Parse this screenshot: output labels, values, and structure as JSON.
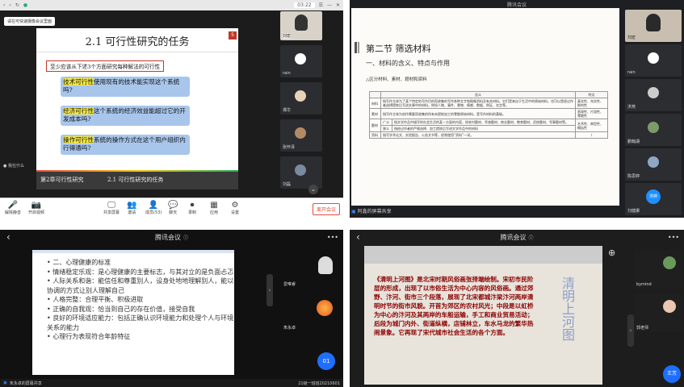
{
  "q1": {
    "browser_time": "03:22",
    "tooltip": "请在可快速摄像会议里面",
    "slide_badge": "5",
    "slide_title": "2.1 可行性研究的任务",
    "slide_intro": "至少应该从下述3个方面研究每种解法的可行性",
    "slide_items": [
      {
        "hl": "技术可行性",
        "rest": "使用现有的技术能实现这个系统吗?"
      },
      {
        "hl": "经济可行性",
        "rest": "这个系统的经济效益能超过它的开发成本吗?"
      },
      {
        "hl": "操作可行性",
        "rest": "系统的操作方式在这个用户组织内行得通吗?"
      }
    ],
    "footer_left": "第2章可行性研究",
    "footer_right": "2.1 可行性研究的任务",
    "presenter_label": "我在什么",
    "participants": [
      "刘宏",
      "rain",
      "谭华",
      "张怀泽",
      "刘磊"
    ],
    "toolbar": [
      {
        "icon": "mic-icon",
        "glyph": "🎤",
        "label": "解除静音"
      },
      {
        "icon": "camera-icon",
        "glyph": "📷",
        "label": "开启视频"
      },
      {
        "icon": "screen-share-icon",
        "glyph": "🖵",
        "label": "共享屏幕"
      },
      {
        "icon": "members-icon",
        "glyph": "👥",
        "label": "邀请"
      },
      {
        "icon": "manage-icon",
        "glyph": "👤",
        "label": "成员(53)"
      },
      {
        "icon": "chat-icon",
        "glyph": "💬",
        "label": "聊天"
      },
      {
        "icon": "record-icon",
        "glyph": "⏺",
        "label": "录制"
      },
      {
        "icon": "apps-icon",
        "glyph": "▦",
        "label": "应用"
      },
      {
        "icon": "settings-icon",
        "glyph": "⚙",
        "label": "设置"
      }
    ],
    "leave_label": "离开会议"
  },
  "q2": {
    "app_title": "腾讯会议",
    "section_title": "第二节 筛选材料",
    "subtitle": "一、材料的含义、特点与作用",
    "small_heading": "△区分材料、素材、题材和资料",
    "table_header": [
      "",
      "含义",
      "特点"
    ],
    "table_rows": [
      {
        "name": "材料",
        "meaning": "指写作主体为了某个特定的写作目的而收集的写作各种文字和图像资料及有关材料。它们是来自于生活中的原始材料，也可以是经过作者选择提炼后写进文章中的材料，例如人物、事件、景物、情感、数据、例证、名言等。",
        "feature": "真实性、充实性、鲜的性"
      },
      {
        "name": "素材",
        "meaning": "指写作主体为创作需要而收集的所有未提炼加工的零散原始材料，是写作材料的基础。",
        "feature": "直观性、片段性、零散性"
      },
      {
        "name": "题材",
        "sub": "广义",
        "meaning": "指文学作品中描写的社会生活的某一方面的内容，如农村题材、军旅题材、商业题材、教育题材、武侠题材、军事题材等。",
        "feature": "艺术性、典型性、概括性"
      },
      {
        "name": "",
        "sub": "狭义",
        "meaning": "指经过作者的严格选择、加工提炼后写进文学作品中的材料",
        "feature": ""
      },
      {
        "name": "资料",
        "meaning": "指写学术论文、实验报告、公务文书等，经常使用“资料”一词。",
        "feature": "/"
      }
    ],
    "share_label": "阿鑫的屏幕共享",
    "participants": [
      "刘宏",
      "rain",
      "洪燕",
      "鹏翰湖",
      "陈思婷",
      "刘健娜"
    ],
    "corner_badge": "洪婷"
  },
  "q3": {
    "app_title": "腾讯会议",
    "bullets": [
      "二、心理健康的标准",
      "情绪稳定乐观：是心理健康的主要标志，与其对立的是负面忐忑",
      "人际关系和谐：能信任和尊重别人，设身处地地理解别人，能以协调的方式让别人理解自己",
      "人格完整：合理平衡、积极进取",
      "正确的自我观：恰当到自己的存在价值，接受自我",
      "良好的环境适应能力：包括正确认识环境能力和处理个人与环境关系的能力",
      "心理行为表现符合年龄特征"
    ],
    "participants": [
      "爱唯睿",
      "朱永卓"
    ],
    "badge": "01",
    "share_label": "朱永卓的屏幕共享",
    "bottom_right": "21级一班班20210601"
  },
  "q4": {
    "app_title": "腾讯会议",
    "paragraph": "《清明上河图》是北宋时期风俗画张择端绘制。宋初市民阶层的形成，出现了以市俗生活为中心内容的风俗画。通过郊野、汴河、街市三个段落，展现了北宋都城汴梁汴河两岸清明时节的街市风貌。开首为郊区的农村风光；中段是以虹桥为中心的汴河及其两岸的车船运输，手工和商业贸易活动；后段为城门内外、街道纵横，店铺林立，车水马龙的繁华热闹景象。它再现了宋代城市社会生活的各个方面。",
    "seal_text": "清明上河图",
    "participants": [
      "bymind",
      "郭老师"
    ],
    "badge": "王芳"
  }
}
